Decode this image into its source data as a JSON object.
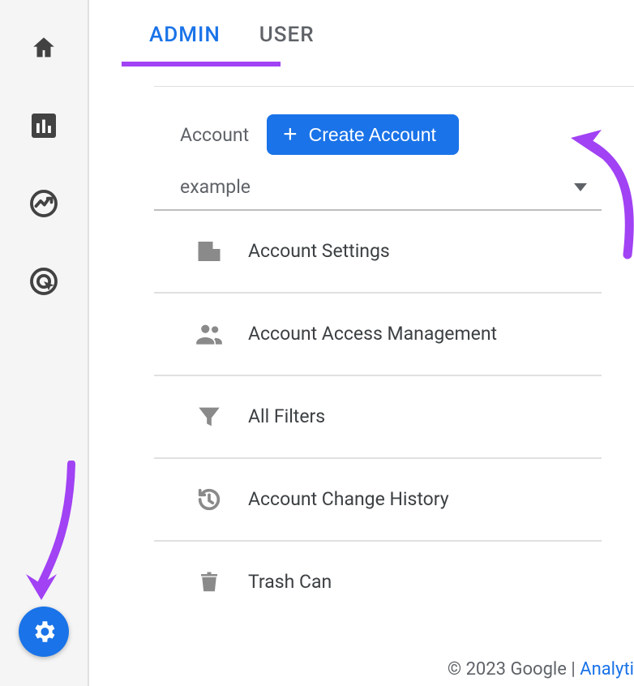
{
  "tabs": {
    "admin": "ADMIN",
    "user": "USER"
  },
  "account": {
    "label": "Account",
    "create_label": "Create Account",
    "selected": "example"
  },
  "menu": {
    "settings": "Account Settings",
    "access": "Account Access Management",
    "filters": "All Filters",
    "history": "Account Change History",
    "trash": "Trash Can"
  },
  "footer": {
    "copyright": "© 2023 Google | ",
    "link": "Analyti"
  }
}
